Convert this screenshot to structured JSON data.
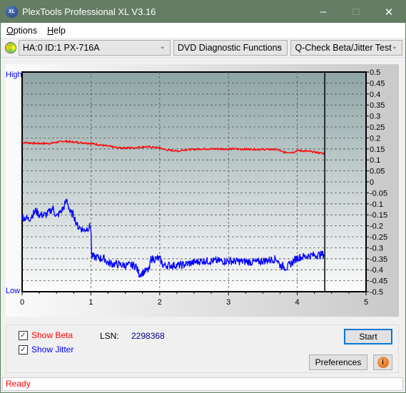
{
  "window": {
    "title": "PlexTools Professional XL V3.16",
    "logo_text": "XL"
  },
  "menu": [
    {
      "label": "Options",
      "u": "O",
      "rest": "ptions"
    },
    {
      "label": "Help",
      "u": "H",
      "rest": "elp"
    }
  ],
  "toolbar": {
    "drive": "HA:0 ID:1  PX-716A",
    "function": "DVD Diagnostic Functions",
    "test": "Q-Check Beta/Jitter Test"
  },
  "chart_data": {
    "type": "line",
    "left_labels": {
      "top": "High",
      "bottom": "Low"
    },
    "xlim": [
      0,
      5
    ],
    "ylim": [
      -0.5,
      0.5
    ],
    "x_ticks": [
      "0",
      "1",
      "2",
      "3",
      "4",
      "5"
    ],
    "y_ticks": [
      "0.5",
      "0.45",
      "0.4",
      "0.35",
      "0.3",
      "0.25",
      "0.2",
      "0.15",
      "0.1",
      "0.05",
      "0",
      "-0.05",
      "-0.1",
      "-0.15",
      "-0.2",
      "-0.25",
      "-0.3",
      "-0.35",
      "-0.4",
      "-0.45",
      "-0.5"
    ],
    "grid": true,
    "marker_x": 4.4,
    "series": [
      {
        "key": "beta",
        "color": "#ff0000",
        "points": [
          [
            0,
            0.18
          ],
          [
            0.2,
            0.175
          ],
          [
            0.4,
            0.175
          ],
          [
            0.6,
            0.185
          ],
          [
            0.8,
            0.18
          ],
          [
            1.0,
            0.175
          ],
          [
            1.2,
            0.165
          ],
          [
            1.4,
            0.155
          ],
          [
            1.6,
            0.155
          ],
          [
            1.8,
            0.16
          ],
          [
            2.0,
            0.155
          ],
          [
            2.1,
            0.145
          ],
          [
            2.3,
            0.14
          ],
          [
            2.32,
            0.145
          ],
          [
            2.6,
            0.15
          ],
          [
            3.0,
            0.15
          ],
          [
            3.4,
            0.148
          ],
          [
            3.7,
            0.148
          ],
          [
            3.8,
            0.135
          ],
          [
            3.95,
            0.135
          ],
          [
            4.0,
            0.143
          ],
          [
            4.2,
            0.138
          ],
          [
            4.4,
            0.128
          ]
        ]
      },
      {
        "key": "jitter",
        "color": "#0000ff",
        "points": [
          [
            0,
            -0.16
          ],
          [
            0.1,
            -0.17
          ],
          [
            0.2,
            -0.13
          ],
          [
            0.25,
            -0.15
          ],
          [
            0.35,
            -0.15
          ],
          [
            0.45,
            -0.12
          ],
          [
            0.5,
            -0.16
          ],
          [
            0.6,
            -0.12
          ],
          [
            0.65,
            -0.08
          ],
          [
            0.7,
            -0.14
          ],
          [
            0.75,
            -0.15
          ],
          [
            0.8,
            -0.2
          ],
          [
            0.9,
            -0.22
          ],
          [
            1.0,
            -0.2
          ],
          [
            1.01,
            -0.34
          ],
          [
            1.2,
            -0.35
          ],
          [
            1.25,
            -0.37
          ],
          [
            1.5,
            -0.38
          ],
          [
            1.65,
            -0.38
          ],
          [
            1.7,
            -0.42
          ],
          [
            1.85,
            -0.4
          ],
          [
            1.87,
            -0.35
          ],
          [
            2.0,
            -0.35
          ],
          [
            2.05,
            -0.38
          ],
          [
            2.3,
            -0.38
          ],
          [
            2.6,
            -0.36
          ],
          [
            3.0,
            -0.36
          ],
          [
            3.4,
            -0.365
          ],
          [
            3.7,
            -0.35
          ],
          [
            3.75,
            -0.38
          ],
          [
            3.85,
            -0.39
          ],
          [
            3.95,
            -0.36
          ],
          [
            4.0,
            -0.345
          ],
          [
            4.2,
            -0.335
          ],
          [
            4.4,
            -0.33
          ]
        ]
      }
    ]
  },
  "controls": {
    "show_beta": "Show Beta",
    "show_jitter": "Show Jitter",
    "lsn_label": "LSN:",
    "lsn_value": "2298368",
    "start": "Start",
    "preferences": "Preferences",
    "info_icon": "info-icon"
  },
  "status": "Ready",
  "colors": {
    "title_bar": "#647d64",
    "beta": "#ff0000",
    "jitter": "#0000ff"
  }
}
